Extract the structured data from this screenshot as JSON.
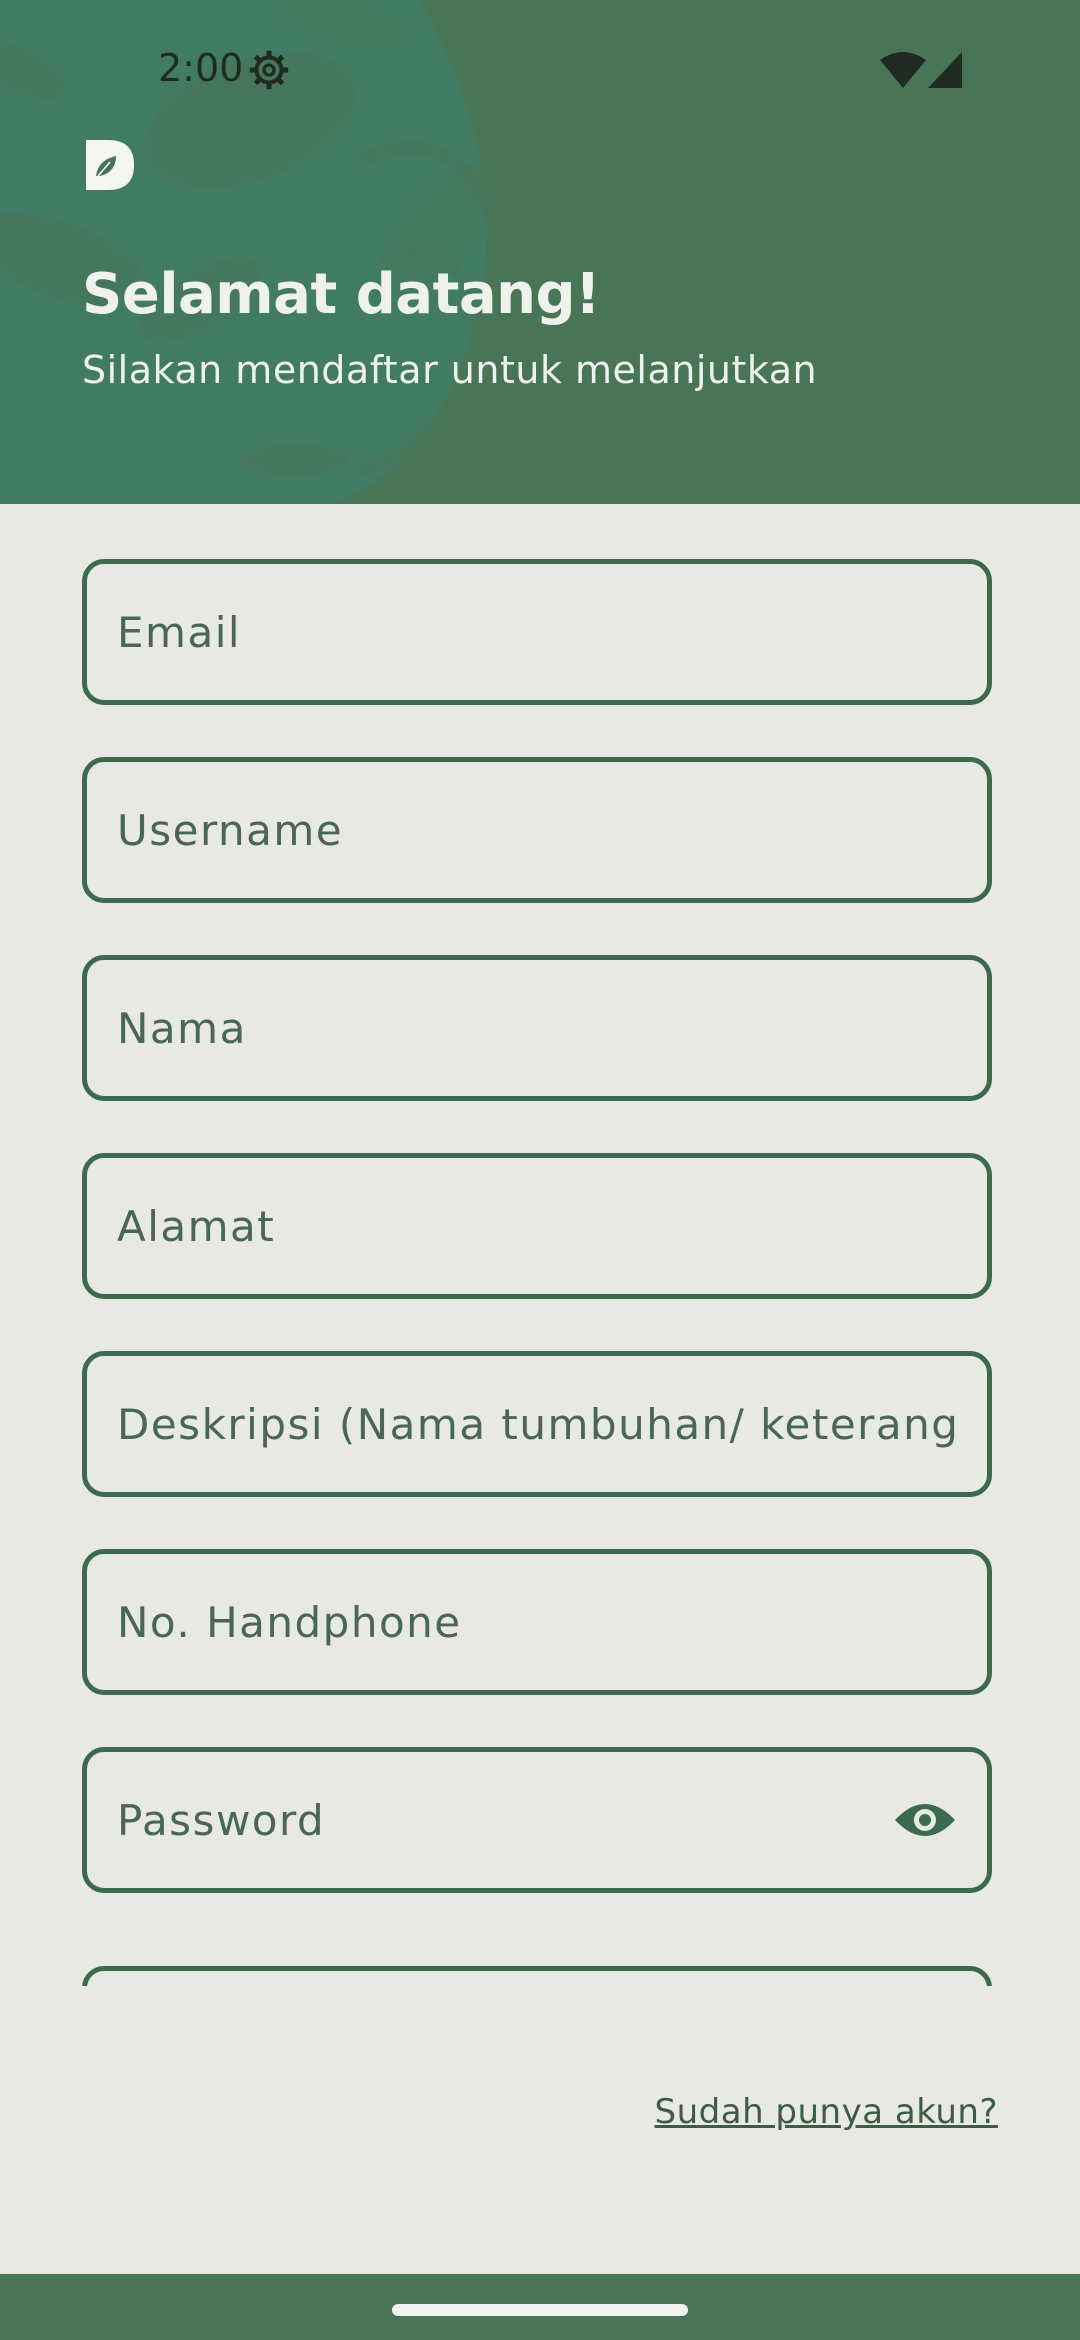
{
  "status_bar": {
    "time": "2:00",
    "icons": [
      "gear-icon",
      "wifi-icon",
      "signal-icon"
    ]
  },
  "header": {
    "logo": "leaf-d-logo",
    "title": "Selamat datang!",
    "subtitle": "Silakan mendaftar untuk melanjutkan"
  },
  "form": {
    "email_placeholder": "Email",
    "username_placeholder": "Username",
    "nama_placeholder": "Nama",
    "alamat_placeholder": "Alamat",
    "deskripsi_placeholder": "Deskripsi (Nama tumbuhan/ keterang...",
    "phone_placeholder": "No. Handphone",
    "password_placeholder": "Password",
    "password_toggle_icon": "eye-icon"
  },
  "login_link": "Sudah punya akun?",
  "colors": {
    "header_bg": "#477556",
    "page_bg": "#e8e8e4",
    "field_border": "#3b6a4e",
    "header_text": "#eef1ec"
  }
}
